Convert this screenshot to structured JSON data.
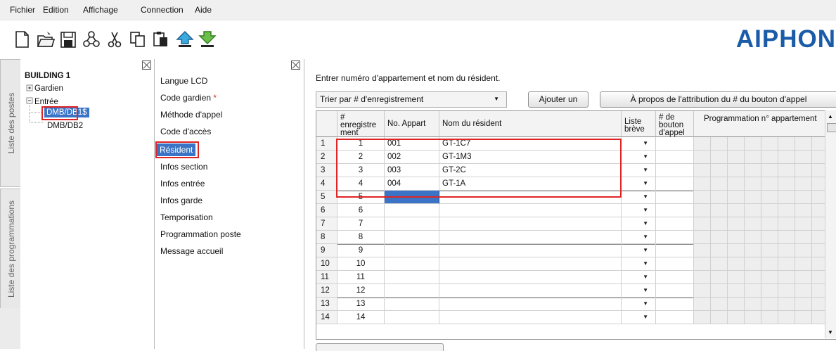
{
  "menu": {
    "items": [
      "Fichier",
      "Edition",
      "Affichage",
      "Connection",
      "Aide"
    ]
  },
  "toolbar": {
    "icons": [
      "new-icon",
      "open-folder-icon",
      "save-icon",
      "network-icon",
      "cut-icon",
      "copy-icon",
      "paste-icon",
      "upload-icon",
      "download-icon"
    ],
    "logo": "AIPHON"
  },
  "side_tabs": {
    "top": "Liste des postes",
    "bottom": "Liste des programmations"
  },
  "tree": {
    "root": "BUILDING 1",
    "gardien": "Gardien",
    "entree": "Entrée",
    "dmb1": "DMB/DB1$",
    "dmb2": "DMB/DB2"
  },
  "settings_menu": {
    "items": [
      "Langue LCD",
      "Code gardien",
      "Méthode d'appel",
      "Code d'accès",
      "Résident",
      "Infos section",
      "Infos entrée",
      "Infos garde",
      "Temporisation",
      "Programmation poste",
      "Message accueil"
    ],
    "required_mark": "*",
    "selected": "Résident"
  },
  "main": {
    "instruction": "Entrer numéro d'appartement et nom du résident.",
    "sort_select": "Trier par # d'enregistrement",
    "add_button": "Ajouter un",
    "about_button": "À propos de l'attribution du # du bouton d'appel"
  },
  "table": {
    "headers": {
      "enreg": "# enregistre ment",
      "appart": "No. Appart",
      "nom": "Nom du résident",
      "liste": "Liste brève",
      "bouton": "# de bouton d'appel",
      "prog": "Programmation n° appartement"
    },
    "rows": [
      {
        "n": "1",
        "rec": "1",
        "appart": "001",
        "name": "GT-1C7"
      },
      {
        "n": "2",
        "rec": "2",
        "appart": "002",
        "name": "GT-1M3"
      },
      {
        "n": "3",
        "rec": "3",
        "appart": "003",
        "name": "GT-2C"
      },
      {
        "n": "4",
        "rec": "4",
        "appart": "004",
        "name": "GT-1A"
      },
      {
        "n": "5",
        "rec": "5",
        "appart": "",
        "name": ""
      },
      {
        "n": "6",
        "rec": "6",
        "appart": "",
        "name": ""
      },
      {
        "n": "7",
        "rec": "7",
        "appart": "",
        "name": ""
      },
      {
        "n": "8",
        "rec": "8",
        "appart": "",
        "name": ""
      },
      {
        "n": "9",
        "rec": "9",
        "appart": "",
        "name": ""
      },
      {
        "n": "10",
        "rec": "10",
        "appart": "",
        "name": ""
      },
      {
        "n": "11",
        "rec": "11",
        "appart": "",
        "name": ""
      },
      {
        "n": "12",
        "rec": "12",
        "appart": "",
        "name": ""
      },
      {
        "n": "13",
        "rec": "13",
        "appart": "",
        "name": ""
      },
      {
        "n": "14",
        "rec": "14",
        "appart": "",
        "name": ""
      }
    ]
  },
  "colors": {
    "accent": "#3b74c6",
    "highlight": "#e02424",
    "logo": "#1b5ca8"
  }
}
